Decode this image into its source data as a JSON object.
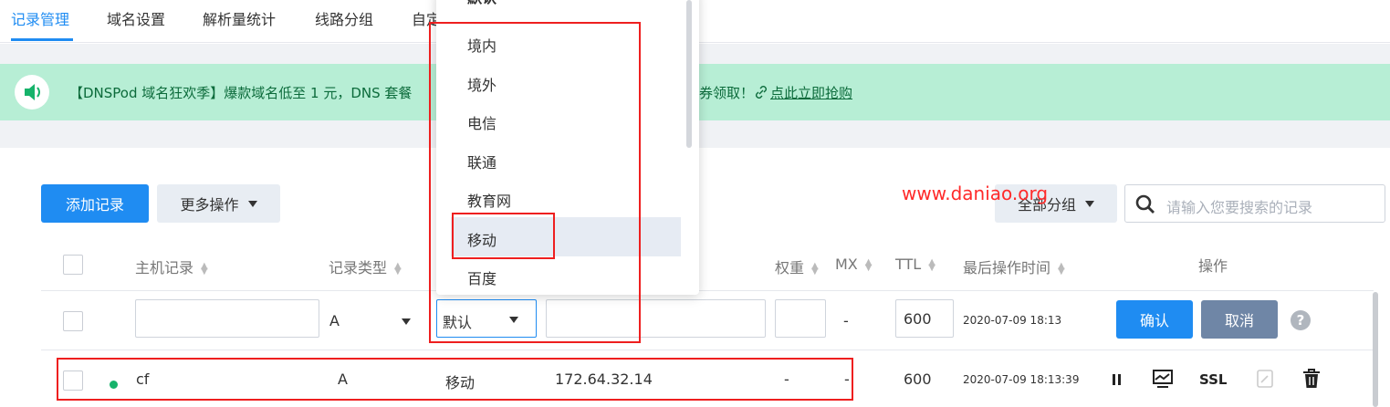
{
  "tabs": [
    {
      "label": "记录管理",
      "active": true
    },
    {
      "label": "域名设置"
    },
    {
      "label": "解析量统计"
    },
    {
      "label": "线路分组"
    },
    {
      "label": "自定"
    }
  ],
  "notice": {
    "text_left": "【DNSPod 域名狂欢季】爆款域名低至 1 元，DNS 套餐",
    "text_right": "券领取！",
    "link": "点此立即抢购",
    "icon": "speaker-icon"
  },
  "toolbar": {
    "add_record": "添加记录",
    "more_actions": "更多操作",
    "group_filter": "全部分组",
    "search_placeholder": "请输入您要搜索的记录"
  },
  "watermark": "www.daniao.org",
  "table": {
    "headers": {
      "host": "主机记录",
      "type": "记录类型",
      "weight": "权重",
      "mx": "MX",
      "ttl": "TTL",
      "last_modified": "最后操作时间",
      "actions": "操作"
    },
    "edit_row": {
      "host": "",
      "type": "A",
      "line": "默认",
      "value": "",
      "weight": "",
      "mx": "-",
      "ttl": "600",
      "time": "2020-07-09 18:13",
      "confirm": "确认",
      "cancel": "取消",
      "help": "?"
    },
    "rows": [
      {
        "host": "cf",
        "type": "A",
        "line": "移动",
        "value": "172.64.32.14",
        "weight": "-",
        "mx": "-",
        "ttl": "600",
        "time": "2020-07-09 18:13:39",
        "ssl": "SSL",
        "status": "enabled"
      }
    ]
  },
  "dropdown": {
    "selected": "默认",
    "options": [
      "默认",
      "境内",
      "境外",
      "电信",
      "联通",
      "教育网",
      "移动",
      "百度"
    ],
    "highlighted": "移动"
  },
  "colors": {
    "accent": "#1f8cf2",
    "notice_bg": "#b7eed5",
    "annotation": "#ee1f1f",
    "status_enabled": "#17b36b"
  }
}
